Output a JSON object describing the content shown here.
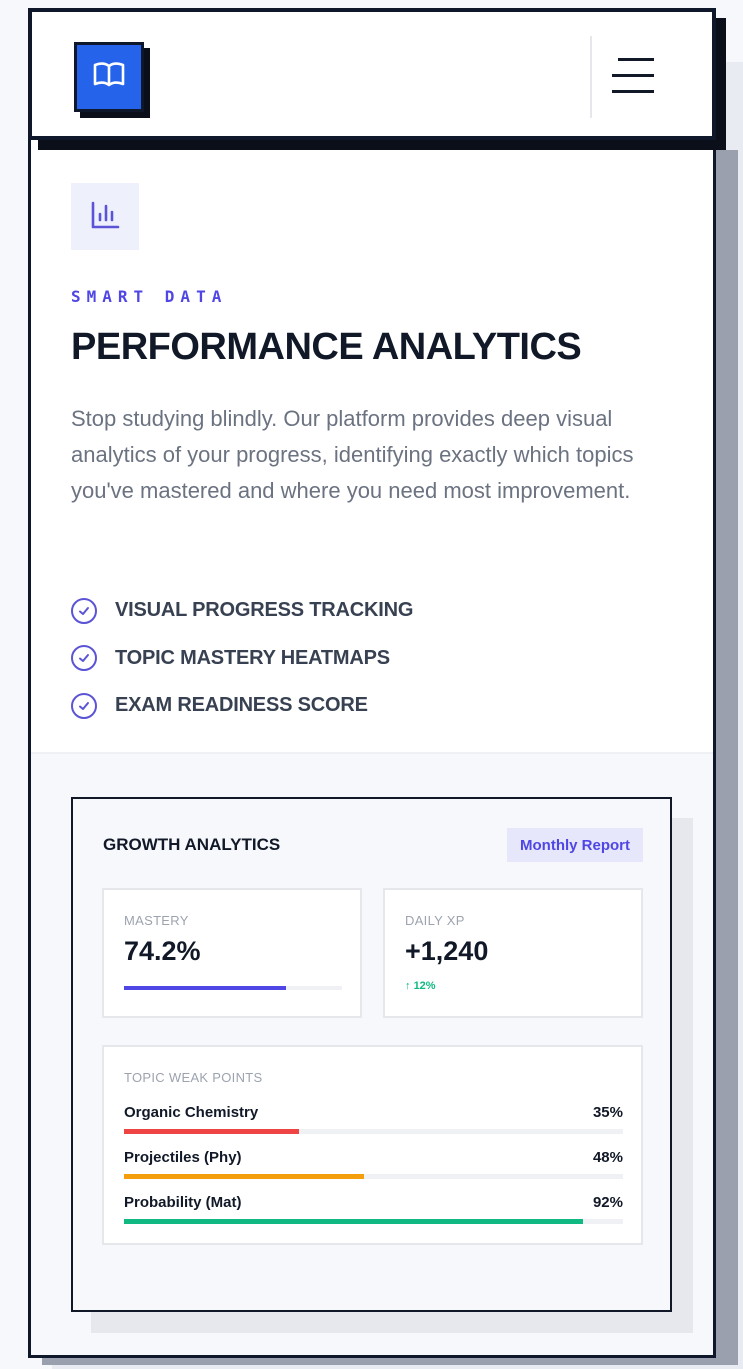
{
  "header": {
    "logo_icon": "open-book-icon",
    "menu_icon": "hamburger-menu-icon"
  },
  "section": {
    "icon": "bar-chart-icon",
    "eyebrow": "SMART DATA",
    "title": "PERFORMANCE ANALYTICS",
    "description": "Stop studying blindly. Our platform provides deep visual analytics of your progress, identifying exactly which topics you've mastered and where you need most improvement.",
    "features": [
      {
        "label": "VISUAL PROGRESS TRACKING",
        "icon": "check-circle-icon"
      },
      {
        "label": "TOPIC MASTERY HEATMAPS",
        "icon": "check-circle-icon"
      },
      {
        "label": "EXAM READINESS SCORE",
        "icon": "check-circle-icon"
      }
    ]
  },
  "dashboard": {
    "title": "GROWTH ANALYTICS",
    "badge": "Monthly Report",
    "stats": {
      "mastery": {
        "label": "MASTERY",
        "value": "74.2%",
        "progress": 0.742
      },
      "daily_xp": {
        "label": "DAILY XP",
        "value": "+1,240",
        "delta": "12%",
        "delta_icon": "arrow-up-icon"
      }
    },
    "weak_points": {
      "heading": "TOPIC WEAK POINTS",
      "items": [
        {
          "name": "Organic Chemistry",
          "pct_label": "35%",
          "value": 35,
          "color": "#ef4444"
        },
        {
          "name": "Projectiles (Phy)",
          "pct_label": "48%",
          "value": 48,
          "color": "#f59e0b"
        },
        {
          "name": "Probability (Mat)",
          "pct_label": "92%",
          "value": 92,
          "color": "#10b981"
        }
      ]
    }
  },
  "colors": {
    "brand": "#2563eb",
    "accent": "#4f46e5",
    "success": "#10b981"
  }
}
